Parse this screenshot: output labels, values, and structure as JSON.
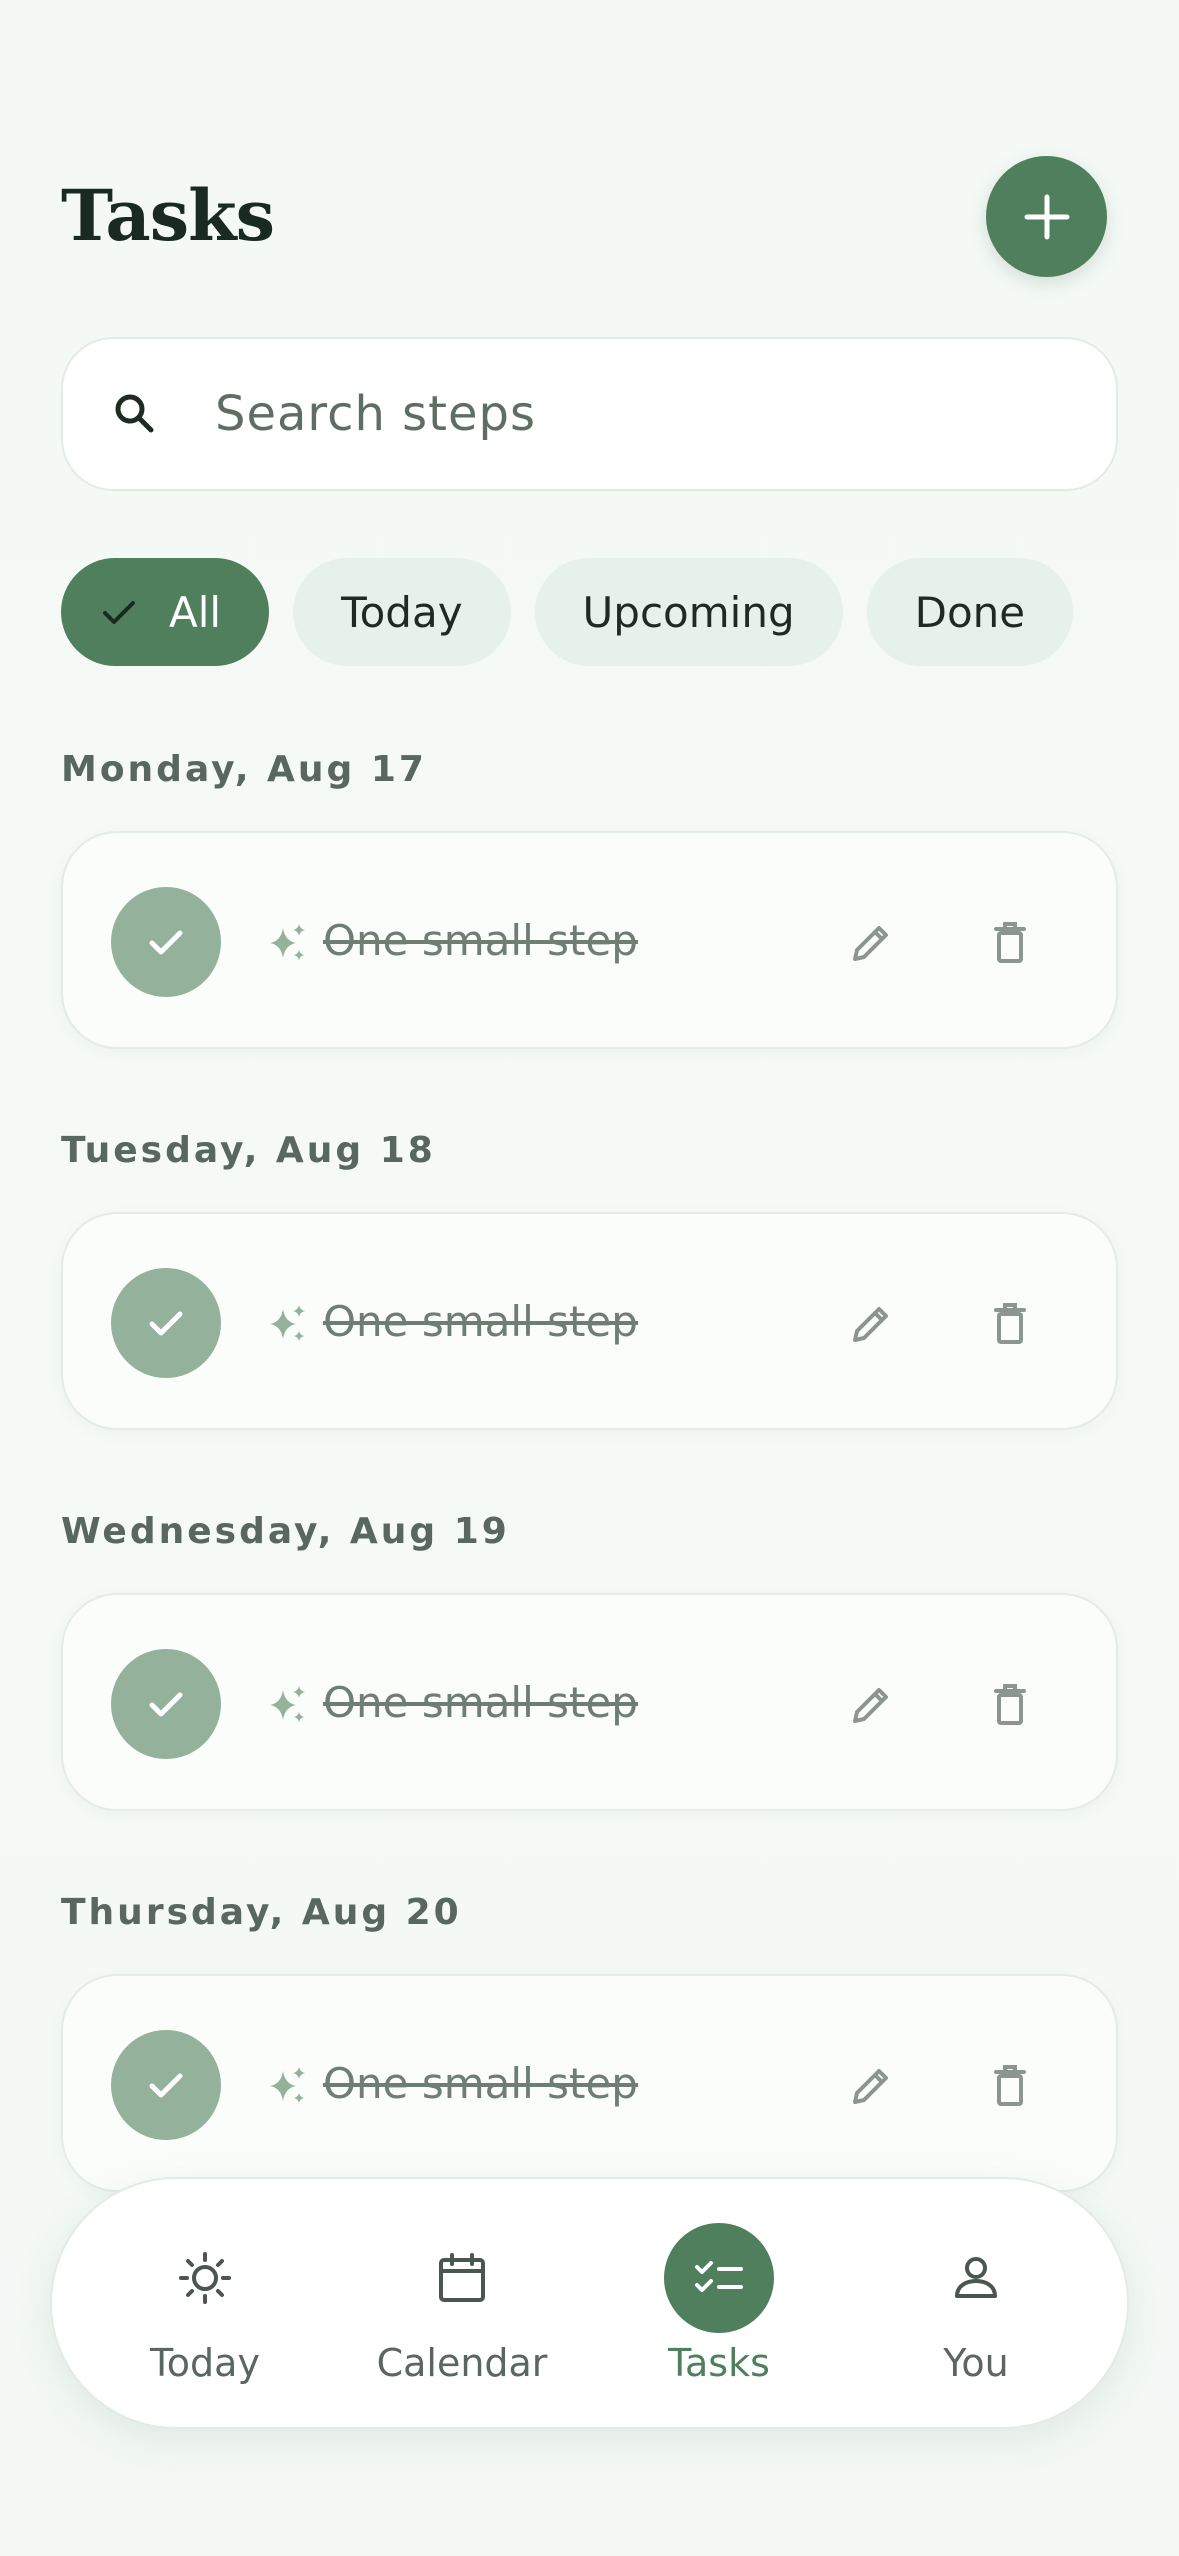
{
  "header": {
    "title": "Tasks",
    "add_icon": "plus-icon"
  },
  "search": {
    "placeholder": "Search steps",
    "value": "",
    "icon": "search-icon"
  },
  "filters": [
    {
      "label": "All",
      "active": true
    },
    {
      "label": "Today",
      "active": false
    },
    {
      "label": "Upcoming",
      "active": false
    },
    {
      "label": "Done",
      "active": false
    }
  ],
  "days": [
    {
      "label": "Monday, Aug 17",
      "task": {
        "title": "One small step",
        "done": true
      }
    },
    {
      "label": "Tuesday, Aug 18",
      "task": {
        "title": "One small step",
        "done": true
      }
    },
    {
      "label": "Wednesday, Aug 19",
      "task": {
        "title": "One small step",
        "done": true
      }
    },
    {
      "label": "Thursday, Aug 20",
      "task": {
        "title": "One small step",
        "done": true
      }
    }
  ],
  "nav": [
    {
      "label": "Today",
      "icon": "sun-icon",
      "active": false
    },
    {
      "label": "Calendar",
      "icon": "calendar-icon",
      "active": false
    },
    {
      "label": "Tasks",
      "icon": "checklist-icon",
      "active": true
    },
    {
      "label": "You",
      "icon": "person-icon",
      "active": false
    }
  ],
  "colors": {
    "accent": "#4f7f5c",
    "done_check": "#94b29b",
    "chip_bg": "#e6f1e9",
    "background": "#f4f9f6"
  }
}
